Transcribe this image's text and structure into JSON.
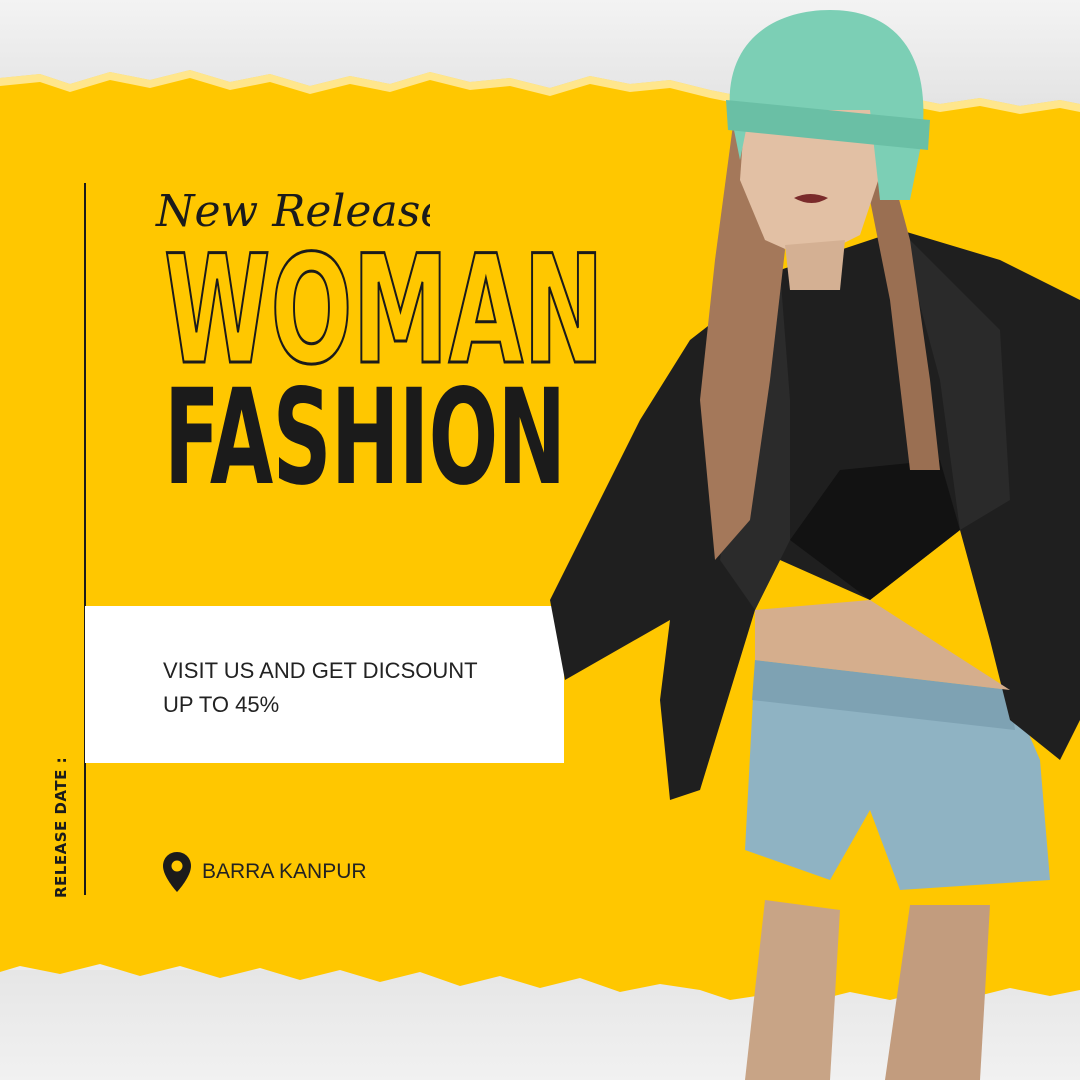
{
  "poster": {
    "script_heading": "New Release",
    "title_line1": "WOMAN",
    "title_line2": "FASHION",
    "promo_line1": "VISIT US AND GET DICSOUNT",
    "promo_line2": "UP TO 45%",
    "release_label": "RELEASE DATE :",
    "location": "BARRA KANPUR"
  },
  "colors": {
    "accent_yellow": "#FFC700",
    "ink": "#1B1B1B",
    "card": "#FFFFFF"
  },
  "icons": {
    "location": "location-pin-icon"
  }
}
